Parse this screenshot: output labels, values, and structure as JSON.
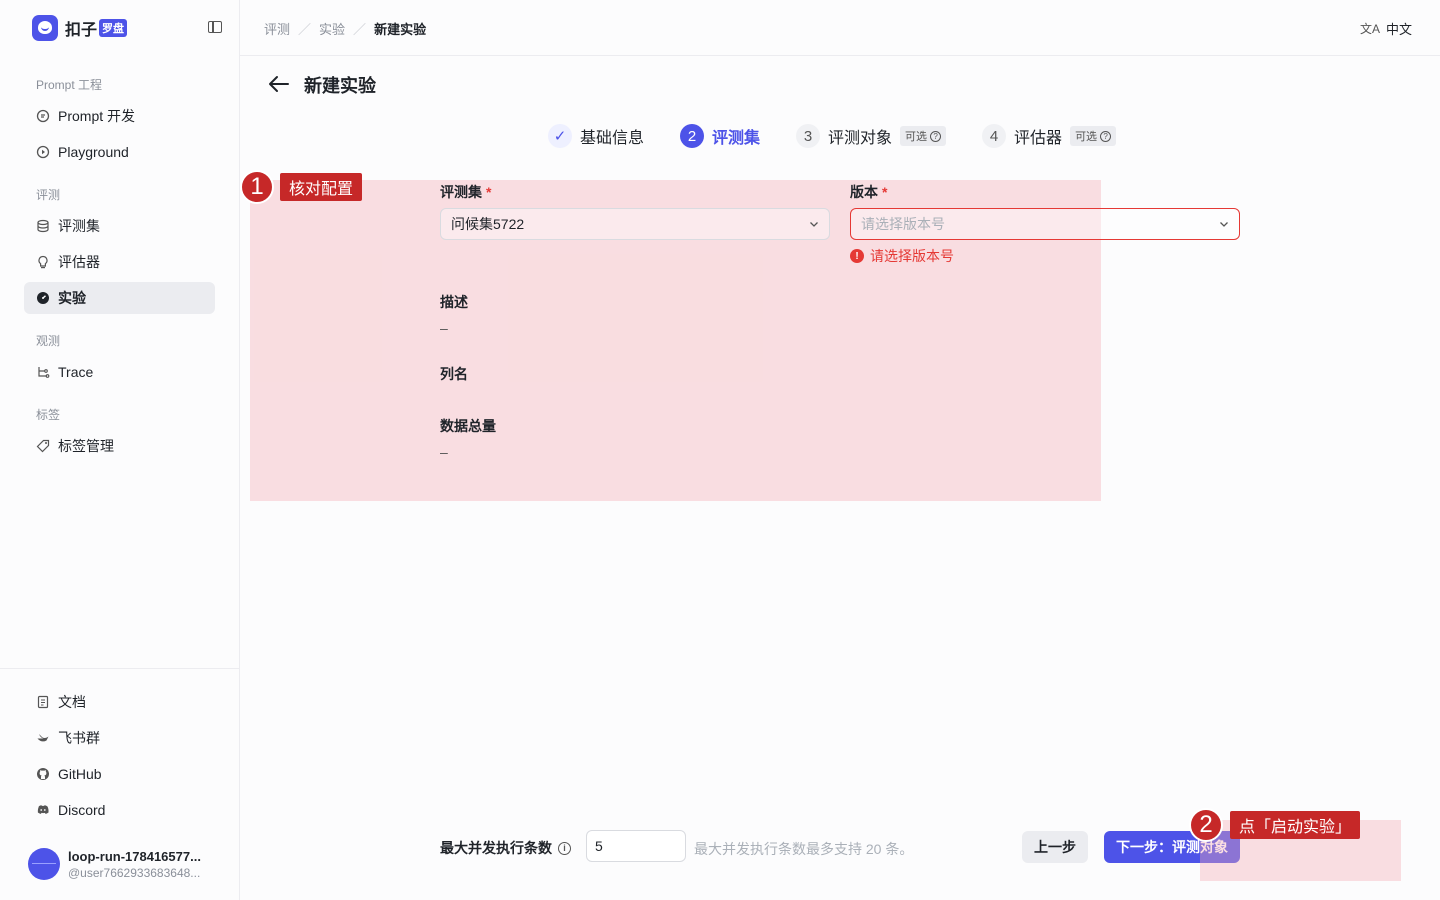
{
  "brand": {
    "name": "扣子",
    "badge": "罗盘"
  },
  "sidebar": {
    "groups": {
      "prompt": "Prompt 工程",
      "eval": "评测",
      "observe": "观测",
      "tags": "标签"
    },
    "items": {
      "prompt_dev": "Prompt 开发",
      "playground": "Playground",
      "eval_set": "评测集",
      "evaluator": "评估器",
      "experiment": "实验",
      "trace": "Trace",
      "tag_manage": "标签管理"
    },
    "bottom": {
      "docs": "文档",
      "feishu": "飞书群",
      "github": "GitHub",
      "discord": "Discord"
    },
    "user": {
      "name": "loop-run-178416577...",
      "id": "@user7662933683648..."
    }
  },
  "topbar": {
    "breadcrumb": [
      "评测",
      "实验",
      "新建实验"
    ],
    "lang_icon": "文A",
    "lang": "中文"
  },
  "page": {
    "title": "新建实验"
  },
  "steps": [
    {
      "num": "✓",
      "label": "基础信息",
      "state": "done"
    },
    {
      "num": "2",
      "label": "评测集",
      "state": "active"
    },
    {
      "num": "3",
      "label": "评测对象",
      "badge": "可选",
      "state": "todo"
    },
    {
      "num": "4",
      "label": "评估器",
      "badge": "可选",
      "state": "todo"
    }
  ],
  "annotations": {
    "m1": {
      "num": "1",
      "label": "核对配置"
    },
    "m2": {
      "num": "2",
      "label": "点「启动实验」"
    }
  },
  "form": {
    "eval_set_label": "评测集",
    "eval_set_value": "问候集5722",
    "version_label": "版本",
    "version_placeholder": "请选择版本号",
    "version_error": "请选择版本号",
    "desc_label": "描述",
    "desc_value": "–",
    "columns_label": "列名",
    "total_label": "数据总量",
    "total_value": "–",
    "required_mark": "*"
  },
  "footer": {
    "concurrency_label": "最大并发执行条数",
    "concurrency_value": "5",
    "concurrency_hint": "最大并发执行条数最多支持 20 条。",
    "prev_label": "上一步",
    "next_label": "下一步：评测对象"
  },
  "colors": {
    "accent": "#4d53e8",
    "error": "#e53935",
    "annotation": "#c62828"
  }
}
